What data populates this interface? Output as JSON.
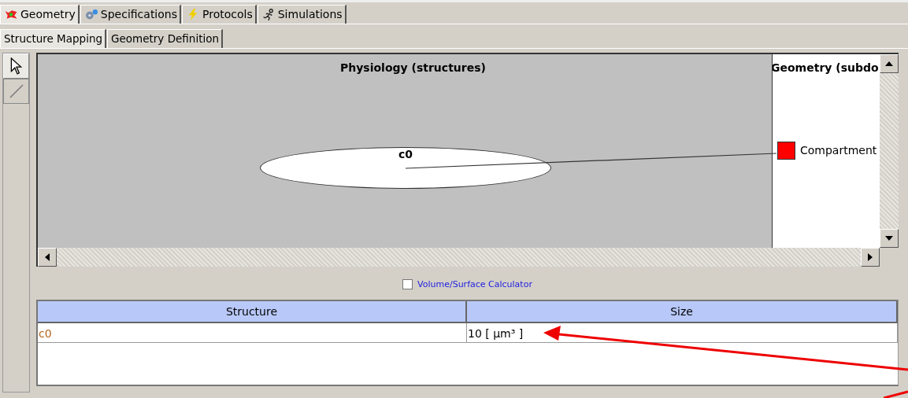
{
  "tabs": [
    {
      "label": "Geometry",
      "selected": true
    },
    {
      "label": "Specifications",
      "selected": false
    },
    {
      "label": "Protocols",
      "selected": false
    },
    {
      "label": "Simulations",
      "selected": false
    }
  ],
  "subtabs": [
    {
      "label": "Structure Mapping",
      "selected": true
    },
    {
      "label": "Geometry Definition",
      "selected": false
    }
  ],
  "tools": [
    {
      "kind": "select",
      "selected": true
    },
    {
      "kind": "line",
      "selected": false
    }
  ],
  "diagram": {
    "physiology_title": "Physiology (structures)",
    "geometry_title": "Geometry (subdo",
    "structure": "c0",
    "subdomain": "Compartment"
  },
  "calculator": {
    "label": "Volume/Surface Calculator",
    "checked": false
  },
  "table": {
    "columns": [
      "Structure",
      "Size"
    ],
    "rows": [
      {
        "structure": "c0",
        "size": "10 [ µm³ ]"
      }
    ]
  }
}
